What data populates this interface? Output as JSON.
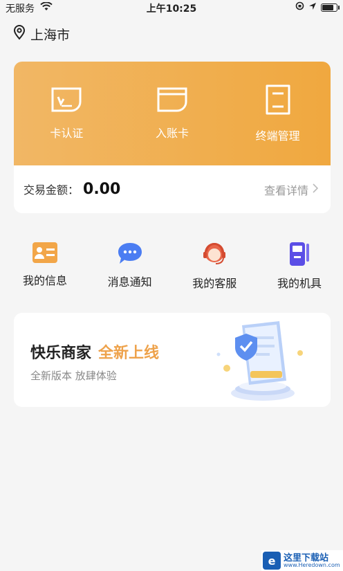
{
  "status_bar": {
    "carrier": "无服务",
    "time": "上午10:25",
    "battery_level": 0.85
  },
  "location": {
    "city": "上海市",
    "icon": "location-pin-icon"
  },
  "card": {
    "actions": [
      {
        "label": "卡认证",
        "icon": "card-verify-icon"
      },
      {
        "label": "入账卡",
        "icon": "deposit-card-icon"
      },
      {
        "label": "终端管理",
        "icon": "terminal-icon"
      }
    ],
    "trade_label": "交易金额：",
    "trade_value": "0.00",
    "details_label": "查看详情"
  },
  "menu": [
    {
      "label": "我的信息",
      "icon": "id-card-icon"
    },
    {
      "label": "消息通知",
      "icon": "message-bubble-icon"
    },
    {
      "label": "我的客服",
      "icon": "customer-service-icon"
    },
    {
      "label": "我的机具",
      "icon": "pos-device-icon"
    }
  ],
  "banner": {
    "title": "快乐商家",
    "title_accent": "全新上线",
    "subtitle": "全新版本 放肆体验"
  },
  "watermark": {
    "line1": "这里下载站",
    "line2": "www.Heredown.com"
  },
  "colors": {
    "accent": "#eea24b",
    "card_gradient_start": "#f1b765",
    "card_gradient_end": "#f0a83f"
  }
}
